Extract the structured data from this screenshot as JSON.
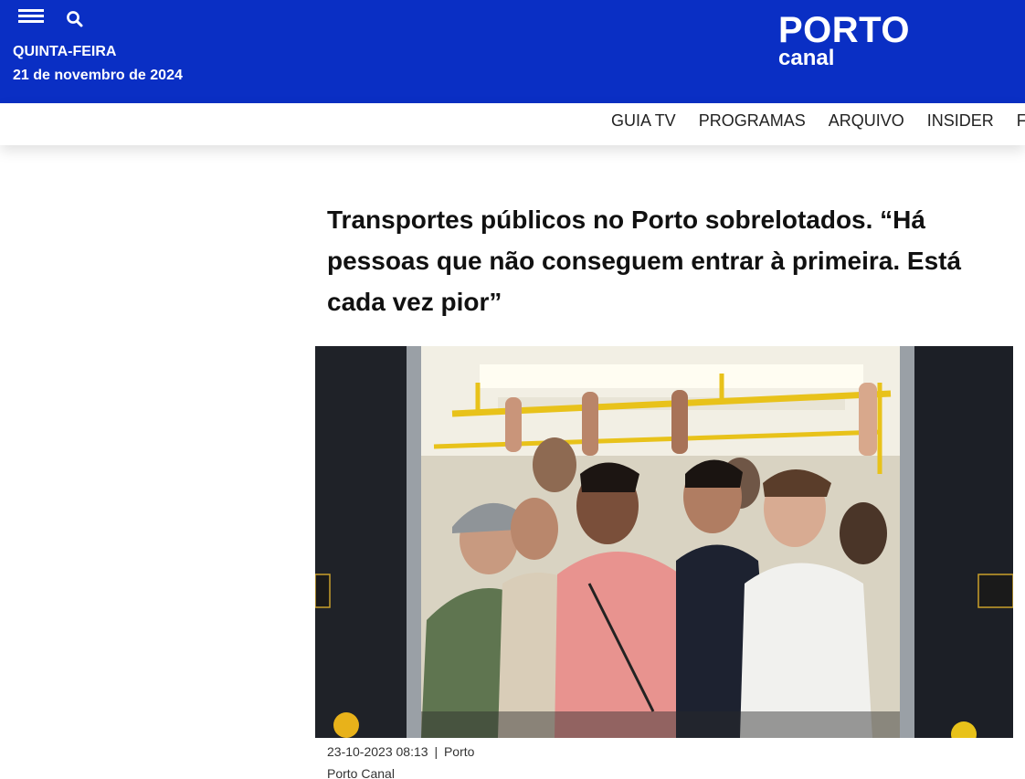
{
  "header": {
    "day": "QUINTA-FEIRA",
    "date": "21 de novembro de 2024",
    "logo_main": "PORTO",
    "logo_sub": "canal",
    "bg_color": "#0a2fc4"
  },
  "nav": {
    "items": [
      "GUIA TV",
      "PROGRAMAS",
      "ARQUIVO",
      "INSIDER",
      "FC P"
    ]
  },
  "article": {
    "title": "Transportes públicos no Porto sobrelotados. “Há pessoas que não conseguem entrar à primeira. Está cada vez pior”",
    "datetime": "23-10-2023 08:13",
    "separator": "|",
    "location": "Porto",
    "author": "Porto Canal"
  }
}
